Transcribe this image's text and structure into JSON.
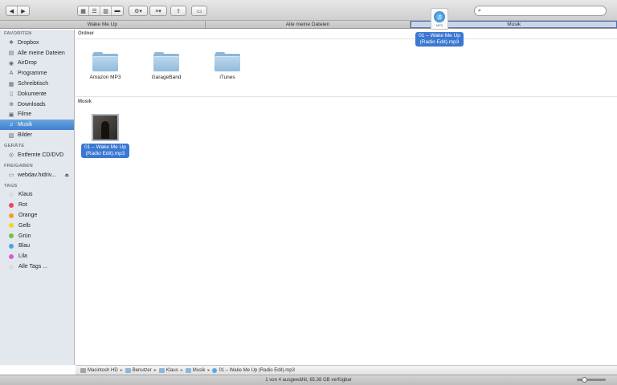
{
  "toolbar": {
    "back_icon": "chevron-left",
    "forward_icon": "chevron-right",
    "view_modes": [
      "icon-view",
      "list-view",
      "column-view",
      "coverflow-view"
    ],
    "search_placeholder": ""
  },
  "tabs": [
    {
      "label": "Wake Me Up"
    },
    {
      "label": "Alle meine Dateien"
    },
    {
      "label": "Musik"
    }
  ],
  "sidebar": {
    "favoriten_header": "FAVORITEN",
    "favoriten": [
      {
        "label": "Dropbox",
        "icon": "dropbox-icon"
      },
      {
        "label": "Alle meine Dateien",
        "icon": "all-files-icon"
      },
      {
        "label": "AirDrop",
        "icon": "airdrop-icon"
      },
      {
        "label": "Programme",
        "icon": "applications-icon"
      },
      {
        "label": "Schreibtisch",
        "icon": "desktop-icon"
      },
      {
        "label": "Dokumente",
        "icon": "documents-icon"
      },
      {
        "label": "Downloads",
        "icon": "downloads-icon"
      },
      {
        "label": "Filme",
        "icon": "movies-icon"
      },
      {
        "label": "Musik",
        "icon": "music-icon"
      },
      {
        "label": "Bilder",
        "icon": "pictures-icon"
      }
    ],
    "geraete_header": "GERÄTE",
    "geraete": [
      {
        "label": "Entfernte CD/DVD",
        "icon": "disc-icon"
      }
    ],
    "freigaben_header": "FREIGABEN",
    "freigaben": [
      {
        "label": "webdav.hidriv...",
        "icon": "server-icon"
      }
    ],
    "tags_header": "TAGS",
    "tags": [
      {
        "label": "Klaus",
        "color": "#d9dde2"
      },
      {
        "label": "Rot",
        "color": "#f0455a"
      },
      {
        "label": "Orange",
        "color": "#f7a020"
      },
      {
        "label": "Gelb",
        "color": "#f2d32a"
      },
      {
        "label": "Grün",
        "color": "#6cc63a"
      },
      {
        "label": "Blau",
        "color": "#4aa3e8"
      },
      {
        "label": "Lila",
        "color": "#d15fd6"
      },
      {
        "label": "Alle Tags ...",
        "color": "#d9dde2"
      }
    ]
  },
  "main": {
    "ordner_header": "Ordner",
    "folders": [
      {
        "label": "Amazon MP3"
      },
      {
        "label": "GarageBand"
      },
      {
        "label": "iTunes"
      }
    ],
    "musik_header": "Musik",
    "file": {
      "label_line1": "01 – Wake Me Up",
      "label_line2": "(Radio Edit).mp3"
    }
  },
  "drag_ghost": {
    "ext": "MP3",
    "label_line1": "01 – Wake Me Up",
    "label_line2": "(Radio Edit).mp3"
  },
  "pathbar": {
    "crumbs": [
      "Macintosh HD",
      "Benutzer",
      "Klaus",
      "Musik",
      "01 – Wake Me Up (Radio Edit).mp3"
    ]
  },
  "status": {
    "text": "1 von 4 ausgewählt, 65,38 GB verfügbar",
    "zoom_level": 0.2
  },
  "colors": {
    "accent": "#3a78d2",
    "sidebar_bg": "#e3e8ee"
  }
}
